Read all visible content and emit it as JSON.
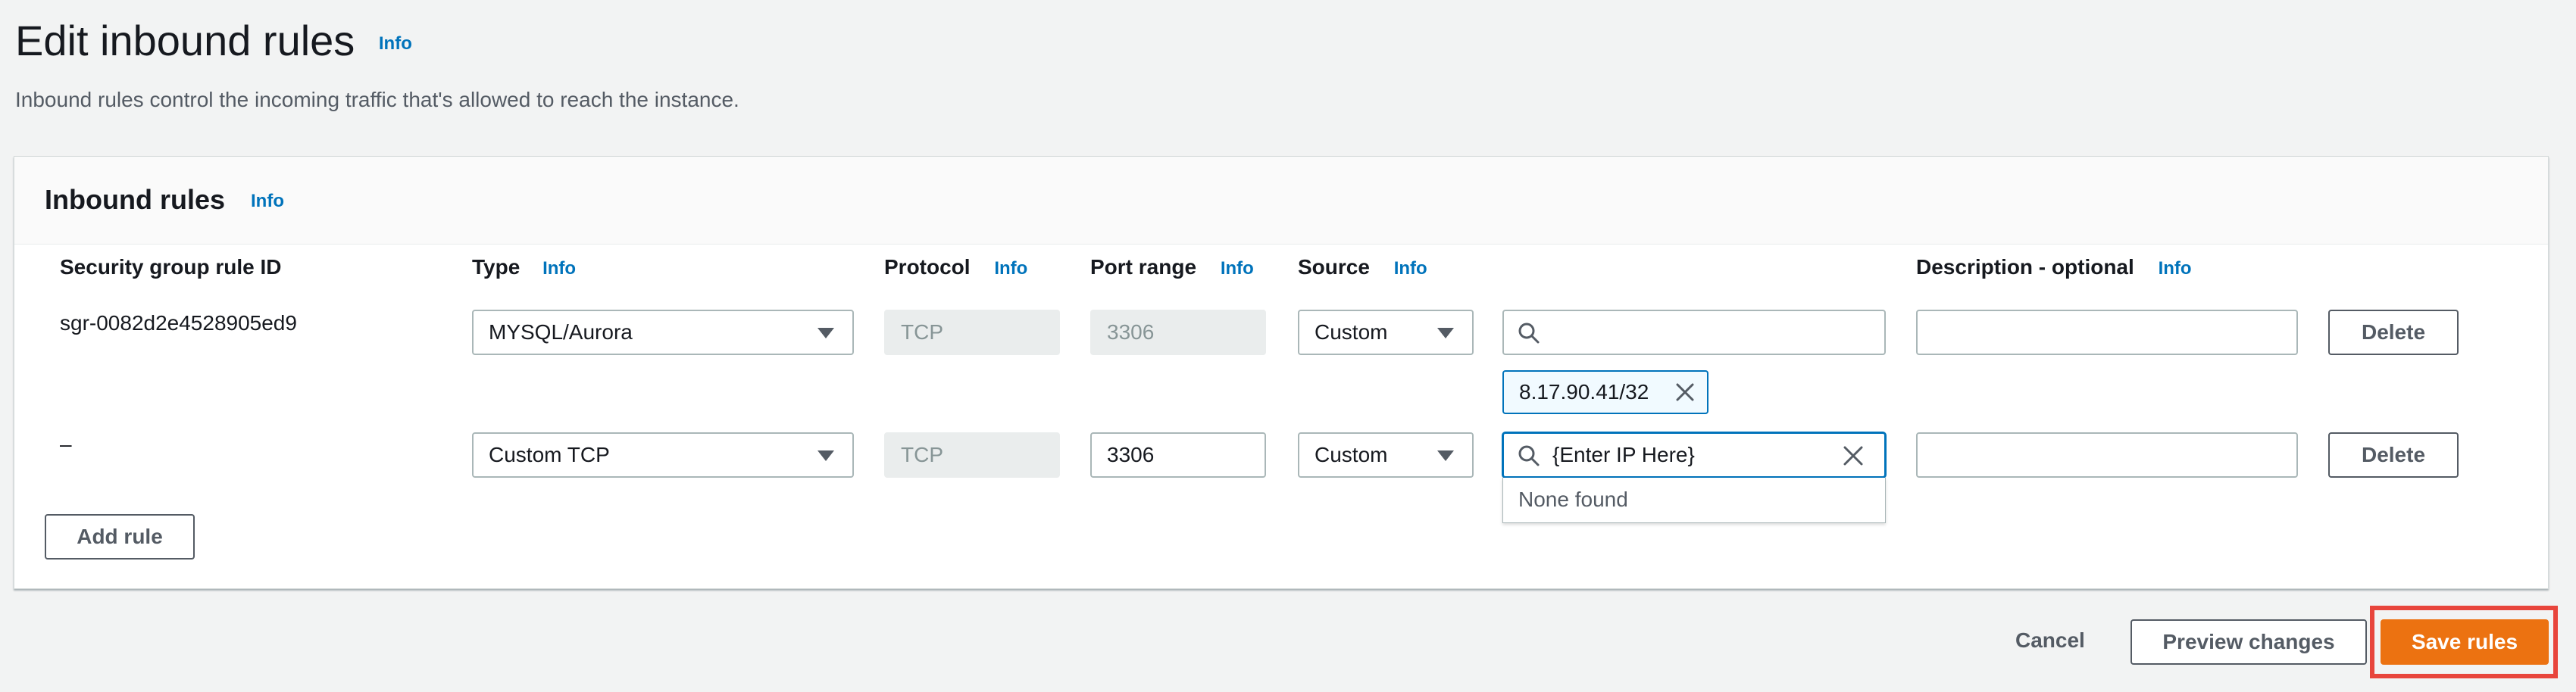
{
  "header": {
    "title": "Edit inbound rules",
    "info": "Info",
    "description": "Inbound rules control the incoming traffic that's allowed to reach the instance."
  },
  "panel": {
    "title": "Inbound rules",
    "info": "Info",
    "columns": {
      "rule_id": "Security group rule ID",
      "type": "Type",
      "type_info": "Info",
      "protocol": "Protocol",
      "protocol_info": "Info",
      "port_range": "Port range",
      "port_range_info": "Info",
      "source": "Source",
      "source_info": "Info",
      "description": "Description - optional",
      "description_info": "Info"
    },
    "rows": [
      {
        "rule_id": "sgr-0082d2e4528905ed9",
        "type": "MYSQL/Aurora",
        "protocol": "TCP",
        "port_range": "3306",
        "source": "Custom",
        "source_search": "",
        "source_token": "8.17.90.41/32",
        "description": "",
        "delete_label": "Delete"
      },
      {
        "rule_id": "–",
        "type": "Custom TCP",
        "protocol": "TCP",
        "port_range": "3306",
        "source": "Custom",
        "source_search": "{Enter IP Here}",
        "dropdown_text": "None found",
        "description": "",
        "delete_label": "Delete"
      }
    ],
    "add_rule_label": "Add rule"
  },
  "footer": {
    "cancel_label": "Cancel",
    "preview_label": "Preview changes",
    "save_label": "Save rules"
  },
  "colors": {
    "primary": "#ec7211",
    "info_link": "#0073bb",
    "highlight": "#e8453c"
  },
  "icons": [
    "search-icon",
    "close-icon",
    "caret-down-icon"
  ]
}
